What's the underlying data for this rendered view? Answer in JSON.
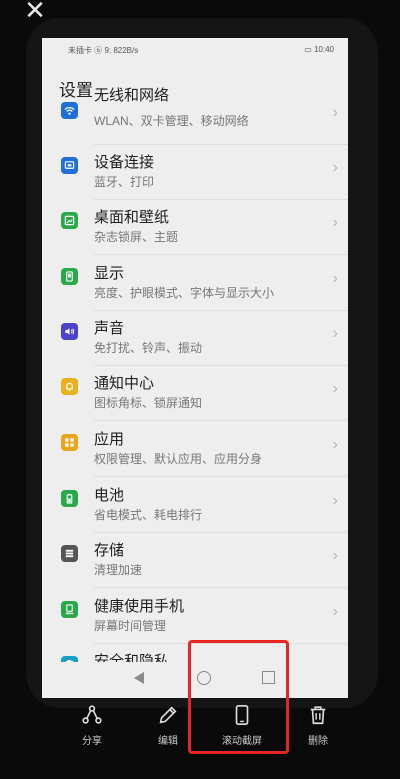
{
  "overlay": {
    "close_symbol": "✕"
  },
  "statusbar": {
    "left": "未插卡 ⓑ 9: 822B/s",
    "right": "▭ 10:40"
  },
  "page_title": "设置",
  "items": [
    {
      "title": "无线和网络",
      "subtitle": "WLAN、双卡管理、移动网络",
      "icon": "wifi-icon",
      "color": "#1f6fd6"
    },
    {
      "title": "设备连接",
      "subtitle": "蓝牙、打印",
      "icon": "device-connect-icon",
      "color": "#1f6fd6"
    },
    {
      "title": "桌面和壁纸",
      "subtitle": "杂志锁屏、主题",
      "icon": "wallpaper-icon",
      "color": "#2aa84a"
    },
    {
      "title": "显示",
      "subtitle": "亮度、护眼模式、字体与显示大小",
      "icon": "display-icon",
      "color": "#2aa84a"
    },
    {
      "title": "声音",
      "subtitle": "免打扰、铃声、振动",
      "icon": "sound-icon",
      "color": "#4a44c8"
    },
    {
      "title": "通知中心",
      "subtitle": "图标角标、锁屏通知",
      "icon": "bell-icon",
      "color": "#e8b21f"
    },
    {
      "title": "应用",
      "subtitle": "权限管理、默认应用、应用分身",
      "icon": "apps-icon",
      "color": "#e8a61f"
    },
    {
      "title": "电池",
      "subtitle": "省电模式、耗电排行",
      "icon": "battery-icon",
      "color": "#2aa84a"
    },
    {
      "title": "存储",
      "subtitle": "清理加速",
      "icon": "storage-icon",
      "color": "#555555"
    },
    {
      "title": "健康使用手机",
      "subtitle": "屏幕时间管理",
      "icon": "health-icon",
      "color": "#2aa84a"
    },
    {
      "title": "安全和隐私",
      "subtitle": "",
      "icon": "security-icon",
      "color": "#1aa0c8"
    }
  ],
  "toolbar": {
    "share": "分享",
    "edit": "编辑",
    "scroll_screenshot": "滚动截屏",
    "delete": "删除"
  },
  "accent": "#e8261f"
}
